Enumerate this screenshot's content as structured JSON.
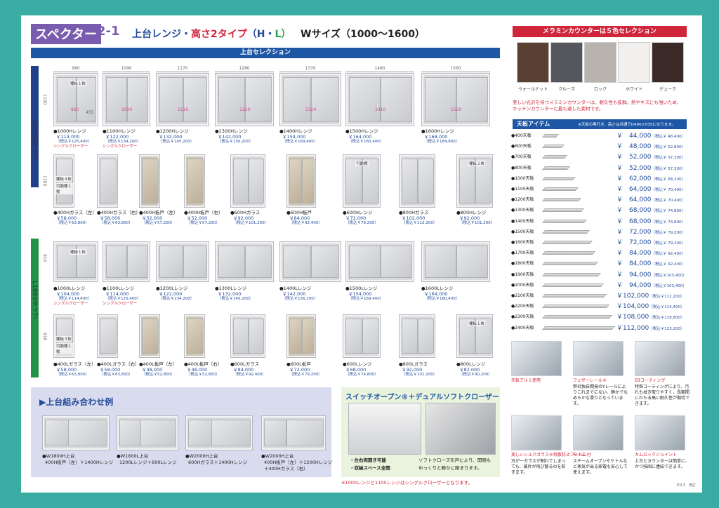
{
  "header": {
    "series": "スペクター",
    "series_num": "2-1",
    "title_a": "上台レンジ・",
    "title_b": "高さ2タイプ",
    "title_c": "（H",
    "title_d": "・",
    "title_e": "L）",
    "wsize": "Wサイズ（1000〜1600）",
    "selection_bar": "上台セレクション"
  },
  "side_labels": {
    "h": "H2050タイプ",
    "l": "L1860タイプ"
  },
  "widths": [
    "980",
    "1090",
    "1170",
    "1280",
    "1370",
    "1480",
    "1560"
  ],
  "dims": {
    "h_height": "1100",
    "inner_455": "455",
    "h_side_1100": "1100",
    "l_height": "910",
    "l_side_910": "910"
  },
  "h_range_inner": [
    "920",
    "1030",
    "1110",
    "1220",
    "1320",
    "1410",
    "1520"
  ],
  "h_range": [
    {
      "label": "●1000Hレンジ",
      "price": "￥114,000",
      "tax": "（税込￥125,400）",
      "note": "シングルクローザー",
      "shelf": "棚板１枚"
    },
    {
      "label": "●1100Hレンジ",
      "price": "￥122,000",
      "tax": "（税込￥134,200）",
      "note": "シングルクローザー"
    },
    {
      "label": "●1200Hレンジ",
      "price": "￥132,000",
      "tax": "（税込￥145,200）"
    },
    {
      "label": "●1300Hレンジ",
      "price": "￥142,000",
      "tax": "（税込￥156,200）"
    },
    {
      "label": "●1400Hレンジ",
      "price": "￥154,000",
      "tax": "（税込￥169,400）"
    },
    {
      "label": "●1500Hレンジ",
      "price": "￥164,000",
      "tax": "（税込￥180,400）"
    },
    {
      "label": "●1600Hレンジ",
      "price": "￥168,000",
      "tax": "（税込￥184,800）"
    }
  ],
  "h_units": [
    {
      "label": "●400Hガラス（左）",
      "price": "￥58,000",
      "tax": "（税込￥63,800）",
      "shelf1": "棚板４枚",
      "shelf2": "可動棚１枚"
    },
    {
      "label": "●400Hガラス（右）",
      "price": "￥58,000",
      "tax": "（税込￥63,800）"
    },
    {
      "label": "●400H板戸（左）",
      "price": "￥52,000",
      "tax": "（税込￥57,200）"
    },
    {
      "label": "●400H板戸（右）",
      "price": "￥52,000",
      "tax": "（税込￥57,200）"
    },
    {
      "label": "●600Hガラス",
      "price": "￥92,000",
      "tax": "（税込￥101,200）"
    },
    {
      "label": "●600H板戸",
      "price": "￥84,000",
      "tax": "（税込￥92,400）"
    },
    {
      "label": "●600Hレンジ",
      "price": "￥72,000",
      "tax": "（税込￥79,200）",
      "shelf": "可動棚"
    },
    {
      "label": "●800Hガラス",
      "price": "￥102,000",
      "tax": "（税込￥112,200）"
    },
    {
      "label": "●800Hレンジ",
      "price": "￥92,000",
      "tax": "（税込￥101,200）",
      "shelf": "棚板２枚"
    }
  ],
  "l_range": [
    {
      "label": "●1000Lレンジ",
      "price": "￥104,000",
      "tax": "（税込￥114,400）",
      "note": "シングルクローザー",
      "shelf": "棚板１枚"
    },
    {
      "label": "●1100Lレンジ",
      "price": "￥114,000",
      "tax": "（税込￥125,400）",
      "note": "シングルクローザー"
    },
    {
      "label": "●1200Lレンジ",
      "price": "￥122,000",
      "tax": "（税込￥134,200）"
    },
    {
      "label": "●1300Lレンジ",
      "price": "￥132,000",
      "tax": "（税込￥145,200）"
    },
    {
      "label": "●1400Lレンジ",
      "price": "￥142,000",
      "tax": "（税込￥156,200）"
    },
    {
      "label": "●1500Lレンジ",
      "price": "￥154,000",
      "tax": "（税込￥169,400）"
    },
    {
      "label": "●1600Lレンジ",
      "price": "￥164,000",
      "tax": "（税込￥180,400）"
    }
  ],
  "l_units": [
    {
      "label": "●400Lガラス（左）",
      "price": "￥58,000",
      "tax": "（税込￥63,800）",
      "shelf1": "棚板３枚",
      "shelf2": "可動棚１枚"
    },
    {
      "label": "●400Lガラス（右）",
      "price": "￥58,000",
      "tax": "（税込￥63,800）"
    },
    {
      "label": "●400L板戸（左）",
      "price": "￥48,000",
      "tax": "（税込￥52,800）"
    },
    {
      "label": "●400L板戸（右）",
      "price": "￥48,000",
      "tax": "（税込￥52,800）"
    },
    {
      "label": "●600Lガラス",
      "price": "￥84,000",
      "tax": "（税込￥92,400）"
    },
    {
      "label": "●600L板戸",
      "price": "￥72,000",
      "tax": "（税込￥79,200）"
    },
    {
      "label": "●600Lレンジ",
      "price": "￥68,000",
      "tax": "（税込￥74,800）"
    },
    {
      "label": "●800Lガラス",
      "price": "￥92,000",
      "tax": "（税込￥101,200）"
    },
    {
      "label": "●800Lレンジ",
      "price": "￥82,000",
      "tax": "（税込￥90,200）",
      "shelf": "棚板１枚"
    }
  ],
  "combo": {
    "title": "▶上台組み合わせ例",
    "examples": [
      {
        "line1": "●W1800H上台",
        "line2": "400H板戸（左）＋1400Hレンジ"
      },
      {
        "line1": "●W1800L上台",
        "line2": "1200Lレンジ＋600Lレンジ"
      },
      {
        "line1": "●W2000H上台",
        "line2": "600Hガラス＋1400Hレンジ"
      },
      {
        "line1": "●W2000H上台",
        "line2": "400H板戸（左）＋1200Hレンジ",
        "line3": "＋400Hガラス（右）"
      }
    ]
  },
  "switch": {
    "title": "スイッチオープン®＋デュアルソフトクローザー",
    "bullet1": "・左右両開き可能",
    "bullet2": "・収納スペース全開",
    "desc1": "ソフトクローズ引戸により、開閉も",
    "desc2": "ゆっくりと静かに閉まります。",
    "footnote": "※1000レンジと1100レンジはシングルクローザーとなります。"
  },
  "melamine": {
    "title": "メラミンカウンターは５色セレクション",
    "swatches": [
      {
        "name": "ウォールナット",
        "color": "#5a3f33"
      },
      {
        "name": "クルーズ",
        "color": "#55575c"
      },
      {
        "name": "ロック",
        "color": "#b9b3ad"
      },
      {
        "name": "ホワイト",
        "color": "#f1f0ee"
      },
      {
        "name": "デューク",
        "color": "#3b2a28"
      }
    ],
    "note1": "美しい光沢を持つメラミンカウンターは、耐久性も抜群。熱やキズにも強いため、",
    "note2": "キッチンカウンターに最も適した素材です。"
  },
  "top_items": {
    "title": "天板アイテム",
    "subnote": "※天板の奥行き、高さは共通でD490×H35になります。",
    "items": [
      {
        "name": "●400天板",
        "price": "￥　44,000",
        "tax": "（税込￥ 48,400）",
        "len": 20
      },
      {
        "name": "●600天板",
        "price": "￥　48,000",
        "tax": "（税込￥ 52,800）",
        "len": 28
      },
      {
        "name": "●700天板",
        "price": "￥　52,000",
        "tax": "（税込￥ 57,200）",
        "len": 32
      },
      {
        "name": "●800天板",
        "price": "￥　52,000",
        "tax": "（税込￥ 57,200）",
        "len": 36
      },
      {
        "name": "●1000天板",
        "price": "￥　62,000",
        "tax": "（税込￥ 68,200）",
        "len": 44
      },
      {
        "name": "●1100天板",
        "price": "￥　64,000",
        "tax": "（税込￥ 70,400）",
        "len": 48
      },
      {
        "name": "●1200天板",
        "price": "￥　64,000",
        "tax": "（税込￥ 70,400）",
        "len": 52
      },
      {
        "name": "●1300天板",
        "price": "￥　68,000",
        "tax": "（税込￥ 74,800）",
        "len": 56
      },
      {
        "name": "●1400天板",
        "price": "￥　68,000",
        "tax": "（税込￥ 74,800）",
        "len": 60
      },
      {
        "name": "●1500天板",
        "price": "￥　72,000",
        "tax": "（税込￥ 79,200）",
        "len": 64
      },
      {
        "name": "●1600天板",
        "price": "￥　72,000",
        "tax": "（税込￥ 79,200）",
        "len": 68
      },
      {
        "name": "●1700天板",
        "price": "￥　84,000",
        "tax": "（税込￥ 92,400）",
        "len": 72
      },
      {
        "name": "●1800天板",
        "price": "￥　84,000",
        "tax": "（税込￥ 92,400）",
        "len": 76
      },
      {
        "name": "●1900天板",
        "price": "￥　94,000",
        "tax": "（税込￥103,400）",
        "len": 80
      },
      {
        "name": "●2000天板",
        "price": "￥　94,000",
        "tax": "（税込￥103,400）",
        "len": 84
      },
      {
        "name": "●2100天板",
        "price": "￥102,000",
        "tax": "（税込￥112,200）",
        "len": 88
      },
      {
        "name": "●2200天板",
        "price": "￥104,000",
        "tax": "（税込￥114,400）",
        "len": 92
      },
      {
        "name": "●2300天板",
        "price": "￥108,000",
        "tax": "（税込￥118,800）",
        "len": 96
      },
      {
        "name": "●2400天板",
        "price": "￥112,000",
        "tax": "（税込￥123,200）",
        "len": 100
      }
    ]
  },
  "features": [
    {
      "title": "天板アルミ使用",
      "text": ""
    },
    {
      "title": "フェザーレール®",
      "text": "弊社独自開発のYレールによりこれまでにない、静かでなめらかな滑りとなっています。"
    },
    {
      "title": "EBコーティング",
      "text": "特殊コーティングにより、汚れも拭き取りやすく、長期間にわたる高い耐久性が期待できます。"
    },
    {
      "title": "美しいシルクガラス®飛散防止フィルム付",
      "text": "万が一ガラスが割れてしまっても、破片が飛び散るのを防ぎます。"
    },
    {
      "title": "モイス",
      "text": "スチームオーブンやケトルなど蒸気が出る家電も安心して使えます。"
    },
    {
      "title": "カムロックジョイント",
      "text": "上台とカウンターは簡単に、かつ強固に連結できます。"
    }
  ],
  "page_no": "P.0-3　改訂"
}
